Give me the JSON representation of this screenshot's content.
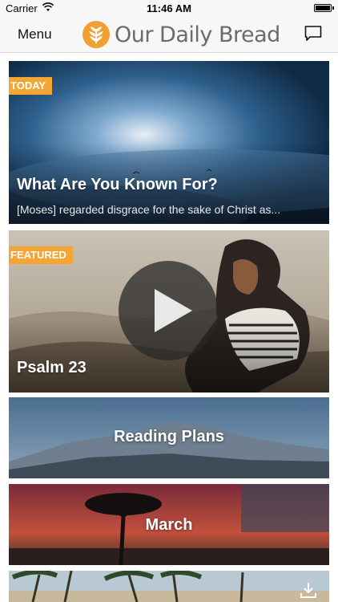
{
  "status_bar": {
    "carrier": "Carrier",
    "time": "11:46 AM",
    "battery_level": 1.0
  },
  "nav": {
    "menu_label": "Menu",
    "app_title": "Our Daily Bread",
    "logo_icon": "wheat-logo-icon",
    "right_icon": "chat-bubble-icon",
    "brand_color": "#f0a033"
  },
  "cards": {
    "today": {
      "tag": "TODAY",
      "title": "What Are You Known For?",
      "excerpt": "[Moses] regarded disgrace for the sake of Christ as..."
    },
    "featured": {
      "tag": "FEATURED",
      "title": "Psalm 23",
      "play_icon": "play-icon"
    },
    "reading_plans": {
      "title": "Reading Plans"
    },
    "march": {
      "title": "March"
    },
    "next": {
      "download_icon": "download-icon"
    }
  },
  "colors": {
    "tag_bg": "#f4a634"
  }
}
